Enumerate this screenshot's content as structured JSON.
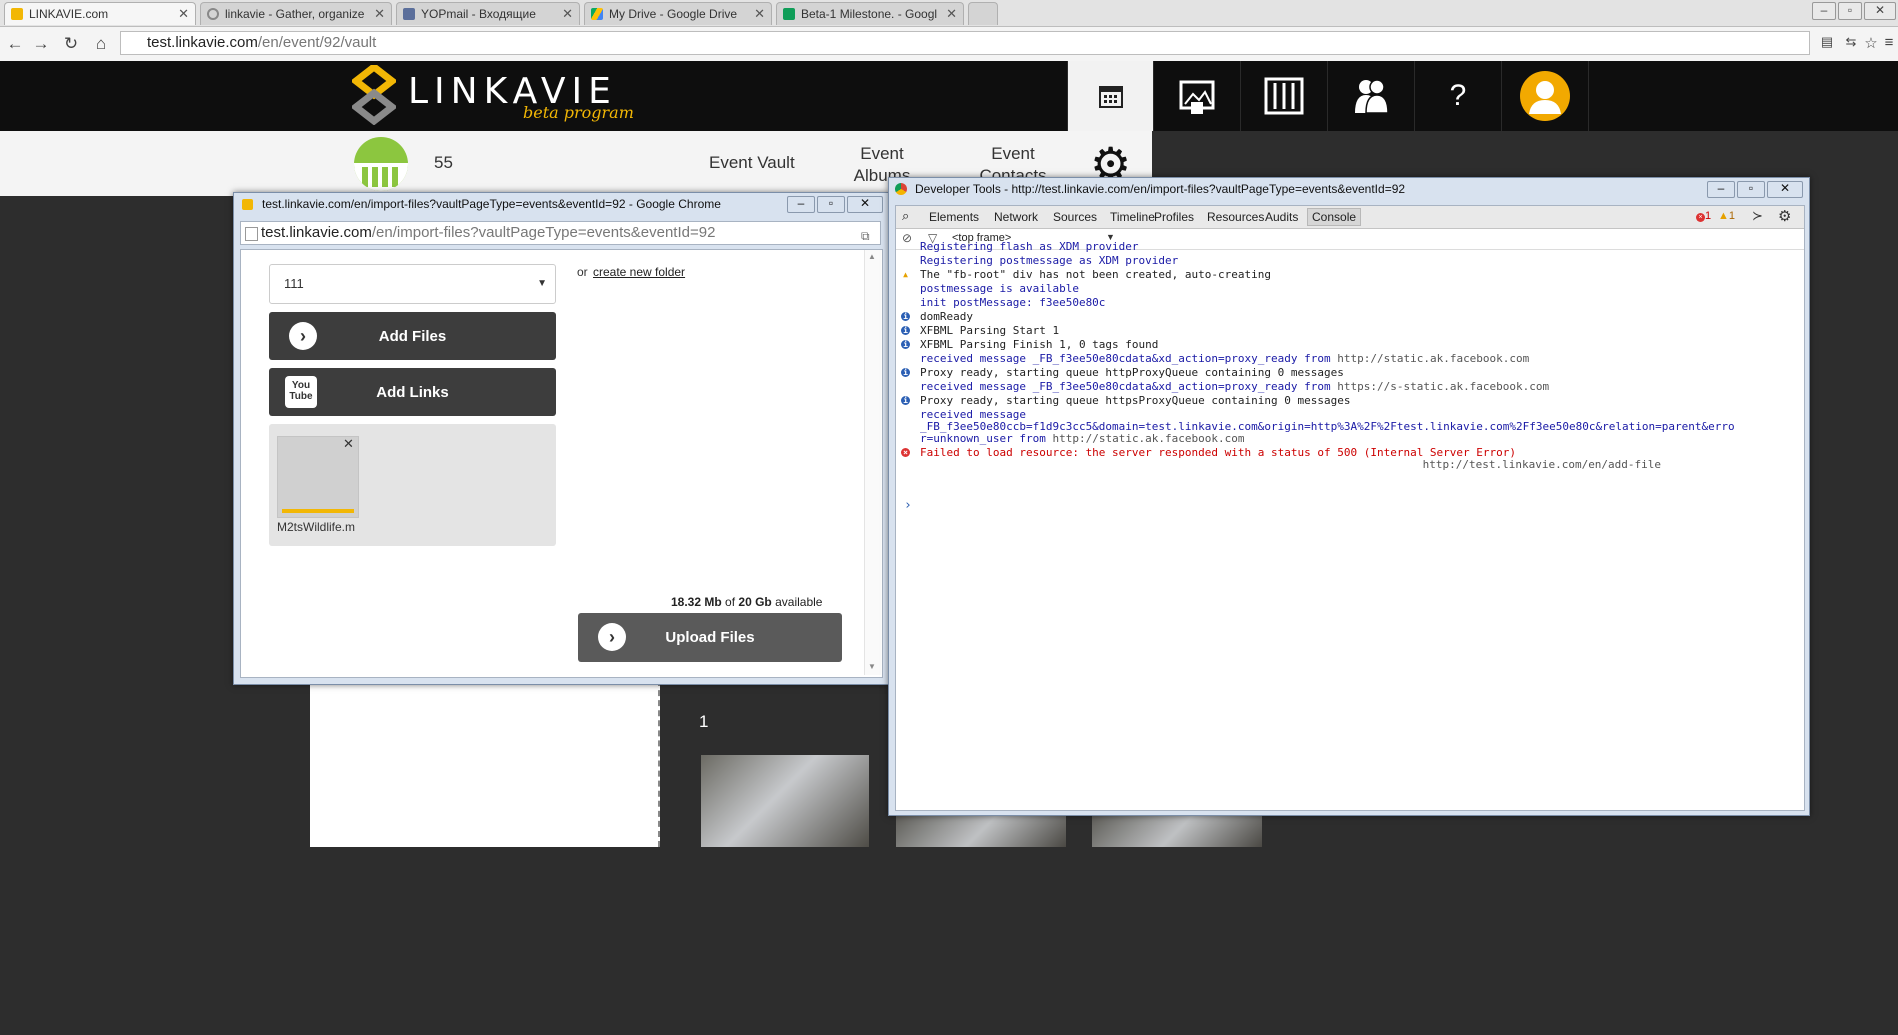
{
  "browser": {
    "tabs": [
      {
        "title": "LINKAVIE.com",
        "active": true,
        "icon": "linkavie-favicon"
      },
      {
        "title": "linkavie - Gather, organize",
        "active": false,
        "icon": "loading-favicon"
      },
      {
        "title": "YOPmail - Входящие",
        "active": false,
        "icon": "yopmail-favicon"
      },
      {
        "title": "My Drive - Google Drive",
        "active": false,
        "icon": "drive-favicon"
      },
      {
        "title": "Beta-1 Milestone. - Googl",
        "active": false,
        "icon": "sheets-favicon"
      }
    ],
    "url_host": "test.linkavie.com",
    "url_path": "/en/event/92/vault"
  },
  "site": {
    "logo_text": "LINKAVIE",
    "logo_sub": "beta program",
    "nav_icons": [
      "calendar-icon",
      "photo-album-icon",
      "vault-icon",
      "contacts-icon",
      "help-icon",
      "user-avatar-icon"
    ],
    "help_label": "?",
    "event_number": "55",
    "subnav": {
      "vault": "Event Vault",
      "albums": "Event Albums",
      "contacts": "Event Contacts"
    },
    "album_count": "1"
  },
  "popup": {
    "title": "test.linkavie.com/en/import-files?vaultPageType=events&eventId=92 - Google Chrome",
    "url_host": "test.linkavie.com",
    "url_path": "/en/import-files?vaultPageType=events&eventId=92",
    "folder_select": "111",
    "or_text": "or",
    "create_folder": "create new folder",
    "add_files": "Add Files",
    "add_links": "Add Links",
    "file_name": "M2tsWildlife.m",
    "used": "18.32 Mb",
    "of": "of",
    "total": "20 Gb",
    "available": "available",
    "upload": "Upload Files"
  },
  "devtools": {
    "title": "Developer Tools - http://test.linkavie.com/en/import-files?vaultPageType=events&eventId=92",
    "tabs": [
      "Elements",
      "Network",
      "Sources",
      "Timeline",
      "Profiles",
      "Resources",
      "Audits",
      "Console"
    ],
    "error_count": "1",
    "warning_count": "1",
    "frame": "<top frame>",
    "log": [
      {
        "type": "log",
        "text": "Registering flash as XDM provider",
        "source": ""
      },
      {
        "type": "log",
        "text": "Registering postmessage as XDM provider",
        "source": ""
      },
      {
        "type": "warn",
        "text": "The \"fb-root\" div has not been created, auto-creating",
        "source": ""
      },
      {
        "type": "log",
        "text": "postmessage is available",
        "source": ""
      },
      {
        "type": "log",
        "text": "init postMessage: f3ee50e80c",
        "source": ""
      },
      {
        "type": "info",
        "text": "domReady",
        "source": ""
      },
      {
        "type": "info",
        "text": "XFBML Parsing Start 1",
        "source": ""
      },
      {
        "type": "info",
        "text": "XFBML Parsing Finish 1, 0 tags found",
        "source": ""
      },
      {
        "type": "log",
        "text": "received message _FB_f3ee50e80cdata&xd_action=proxy_ready from",
        "source": "http://static.ak.facebook.com"
      },
      {
        "type": "info",
        "text": "Proxy ready, starting queue httpProxyQueue containing 0 messages",
        "source": ""
      },
      {
        "type": "log",
        "text": "received message _FB_f3ee50e80cdata&xd_action=proxy_ready from",
        "source": "https://s-static.ak.facebook.com"
      },
      {
        "type": "info",
        "text": "Proxy ready, starting queue httpsProxyQueue containing 0 messages",
        "source": ""
      },
      {
        "type": "log",
        "text": "received message",
        "source": ""
      },
      {
        "type": "log",
        "text": "_FB_f3ee50e80ccb=f1d9c3cc5&domain=test.linkavie.com&origin=http%3A%2F%2Ftest.linkavie.com%2Ff3ee50e80c&relation=parent&erro",
        "source": ""
      },
      {
        "type": "log",
        "text": "r=unknown_user from",
        "source": "http://static.ak.facebook.com"
      },
      {
        "type": "error",
        "text": "Failed to load resource: the server responded with a status of 500 (Internal Server Error)",
        "source": ""
      },
      {
        "type": "source",
        "text": "",
        "source": "http://test.linkavie.com/en/add-file"
      }
    ],
    "prompt": "›"
  },
  "colors": {
    "accent_yellow": "#f2b705",
    "event_green": "#8cc63f",
    "dark_button": "#3d3d3d",
    "log_blue": "#1a1aa6",
    "error_red": "#c00000"
  }
}
